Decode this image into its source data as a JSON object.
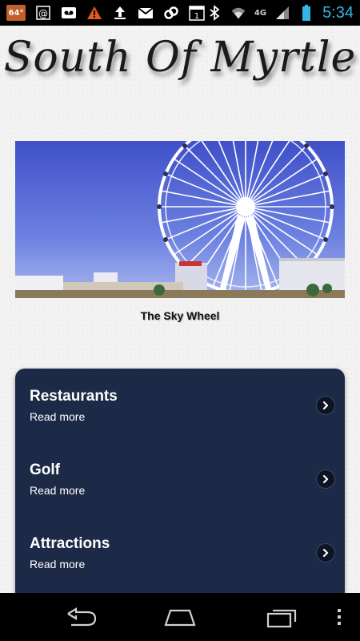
{
  "status_bar": {
    "temperature": "64°",
    "network": "4G",
    "time": "5:34",
    "icons": [
      "weather-badge",
      "email-at-icon",
      "voicemail-icon",
      "warning-icon",
      "upload-icon",
      "gmail-icon",
      "link-icon",
      "calendar-icon",
      "bluetooth-icon",
      "wifi-icon",
      "signal-icon",
      "battery-icon"
    ],
    "calendar_day": "1"
  },
  "header": {
    "title": "South Of Myrtle"
  },
  "hero": {
    "caption": "The Sky Wheel",
    "image_subject": "ferris-wheel-photo"
  },
  "menu": {
    "items": [
      {
        "title": "Restaurants",
        "subtitle": "Read more"
      },
      {
        "title": "Golf",
        "subtitle": "Read more"
      },
      {
        "title": "Attractions",
        "subtitle": "Read more"
      }
    ]
  },
  "colors": {
    "panel_bg": "#1c2a47",
    "clock": "#33b5e5",
    "temp_badge": "#c0602a"
  },
  "nav_bar": {
    "buttons": [
      "back-button",
      "home-button",
      "recent-apps-button",
      "overflow-menu-button"
    ]
  }
}
